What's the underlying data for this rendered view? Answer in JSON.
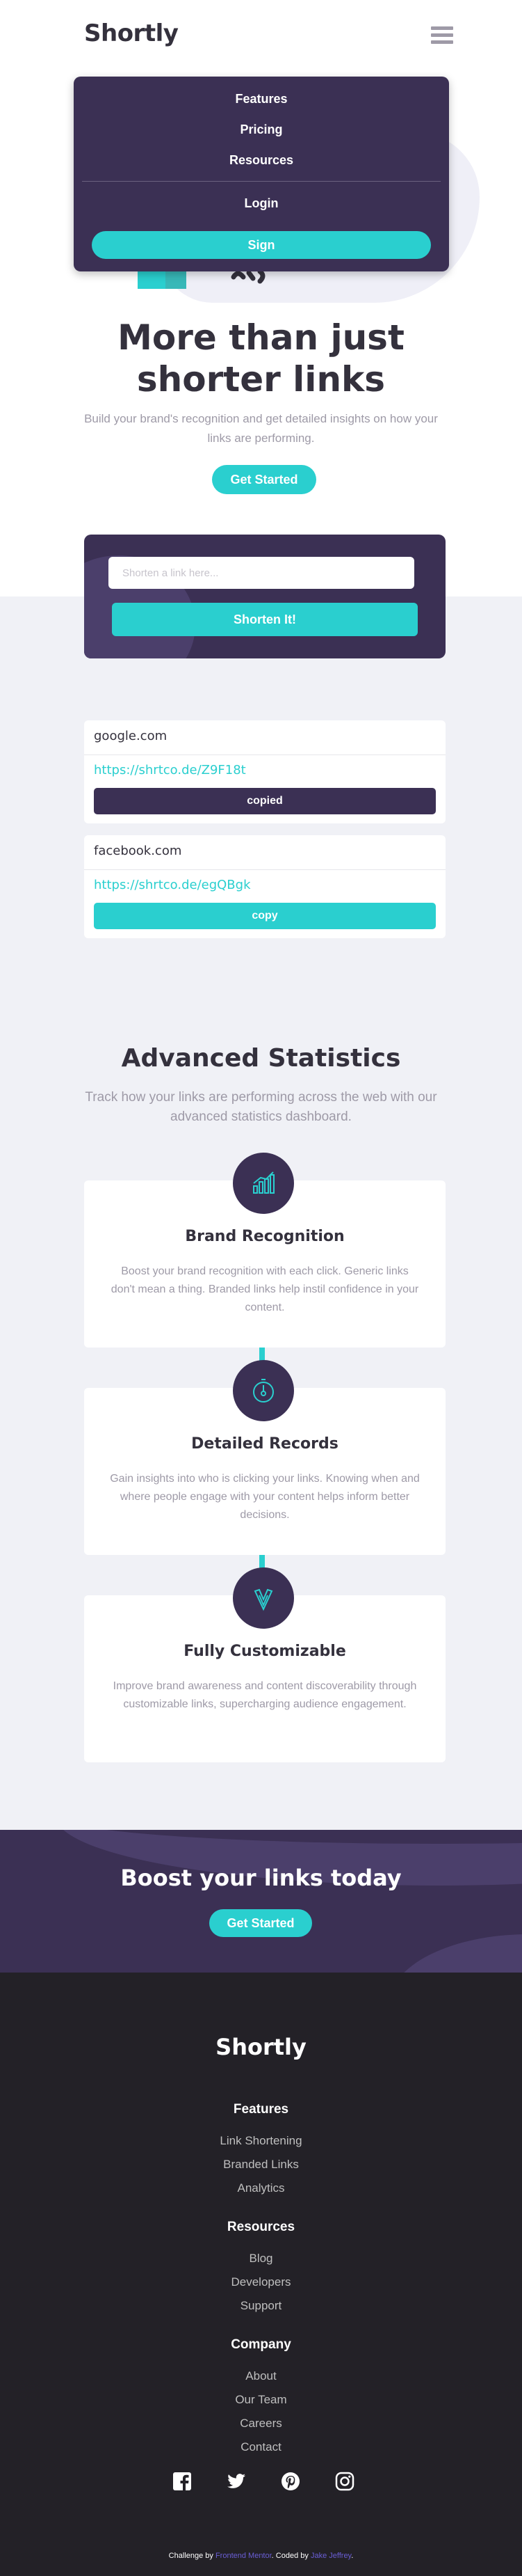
{
  "header": {
    "logo": "Shortly"
  },
  "menu": {
    "items": [
      "Features",
      "Pricing",
      "Resources"
    ],
    "login": "Login",
    "signup": "Sign"
  },
  "hero": {
    "title_line1": "More than just",
    "title_line2": "shorter links",
    "subtitle": "Build your brand's recognition and get detailed insights on how your links are performing.",
    "cta": "Get Started"
  },
  "shorten": {
    "placeholder": "Shorten a link here...",
    "button": "Shorten It!"
  },
  "results": [
    {
      "original": "google.com",
      "short": "https://shrtco.de/Z9F18t",
      "button": "copied",
      "button_color": "#3b3054"
    },
    {
      "original": "facebook.com",
      "short": "https://shrtco.de/egQBgk",
      "button": "copy",
      "button_color": "#2acfcf"
    }
  ],
  "stats": {
    "title": "Advanced Statistics",
    "subtitle": "Track how your links are performing across the web with our advanced statistics dashboard.",
    "cards": [
      {
        "icon": "chart-icon",
        "title": "Brand Recognition",
        "text": "Boost your brand recognition with each click. Generic links don't mean a thing. Branded links help instil confidence in your content."
      },
      {
        "icon": "gauge-icon",
        "title": "Detailed Records",
        "text": "Gain insights into who is clicking your links. Knowing when and where people engage with your content helps inform better decisions."
      },
      {
        "icon": "brush-icon",
        "title": "Fully Customizable",
        "text": "Improve brand awareness and content discoverability through customizable links, supercharging audience engagement."
      }
    ]
  },
  "boost": {
    "title": "Boost your links today",
    "cta": "Get Started"
  },
  "footer": {
    "logo": "Shortly",
    "columns": [
      {
        "title": "Features",
        "links": [
          "Link Shortening",
          "Branded Links",
          "Analytics"
        ]
      },
      {
        "title": "Resources",
        "links": [
          "Blog",
          "Developers",
          "Support"
        ]
      },
      {
        "title": "Company",
        "links": [
          "About",
          "Our Team",
          "Careers",
          "Contact"
        ]
      }
    ],
    "social": [
      "facebook-icon",
      "twitter-icon",
      "pinterest-icon",
      "instagram-icon"
    ],
    "attribution": {
      "prefix": "Challenge by",
      "challenge_link": "Frontend Mentor",
      "middle": "Coded by",
      "author_link": "Jake Jeffrey"
    }
  },
  "colors": {
    "cyan": "#2acfcf",
    "dark_violet": "#3b3054",
    "very_dark": "#232127",
    "gray_text": "#9e9aa7",
    "light_bg": "#f0f1f6"
  }
}
